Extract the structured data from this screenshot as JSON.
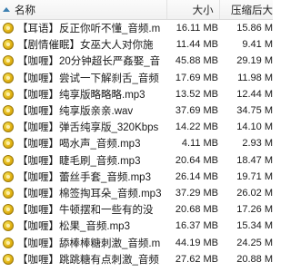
{
  "columns": {
    "name": "名称",
    "size": "大小",
    "compressed": "压缩后大"
  },
  "files": [
    {
      "name": "【耳语】反正你听不懂_音频.m",
      "size": "16.11 MB",
      "compressed": "15.86 M"
    },
    {
      "name": "【剧情催眠】女巫大人对你施",
      "size": "11.44 MB",
      "compressed": "9.41 M"
    },
    {
      "name": "【咖喱】20分钟超长严姦娶_音",
      "size": "45.88 MB",
      "compressed": "29.19 M"
    },
    {
      "name": "【咖喱】尝试一下解刹舌_音频",
      "size": "17.69 MB",
      "compressed": "11.98 M"
    },
    {
      "name": "【咖喱】纯享版略略略.mp3",
      "size": "13.52 MB",
      "compressed": "12.44 M"
    },
    {
      "name": "【咖喱】纯享版亲亲.wav",
      "size": "37.69 MB",
      "compressed": "34.75 M"
    },
    {
      "name": "【咖喱】弹舌纯享版_320Kbps",
      "size": "14.22 MB",
      "compressed": "14.10 M"
    },
    {
      "name": "【咖喱】喝水声_音频.mp3",
      "size": "4.11 MB",
      "compressed": "2.93 M"
    },
    {
      "name": "【咖喱】睫毛刷_音频.mp3",
      "size": "20.64 MB",
      "compressed": "18.47 M"
    },
    {
      "name": "【咖喱】蕾丝手套_音频.mp3",
      "size": "26.14 MB",
      "compressed": "19.71 M"
    },
    {
      "name": "【咖喱】棉签掏耳朵_音频.mp3",
      "size": "37.29 MB",
      "compressed": "26.02 M"
    },
    {
      "name": "【咖喱】牛顿摆和一些有的没",
      "size": "20.68 MB",
      "compressed": "17.26 M"
    },
    {
      "name": "【咖喱】松果_音频.mp3",
      "size": "16.37 MB",
      "compressed": "15.34 M"
    },
    {
      "name": "【咖喱】舔棒棒糖刺激_音频.m",
      "size": "44.19 MB",
      "compressed": "24.25 M"
    },
    {
      "name": "【咖喱】跳跳糖有点刺激_音频",
      "size": "27.62 MB",
      "compressed": "20.88 M"
    }
  ],
  "icons": {
    "file": "audio-file-icon",
    "sort": "sort-ascending-icon"
  },
  "colors": {
    "header_bg": "#f4f4f4",
    "icon_gold": "#e3b414",
    "sort_arrow": "#3c7fb1"
  }
}
